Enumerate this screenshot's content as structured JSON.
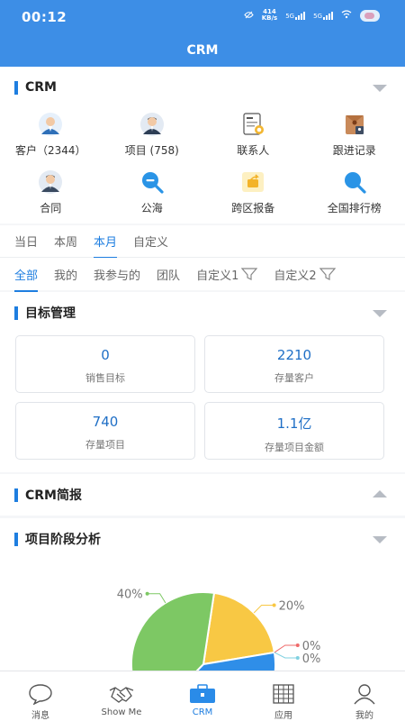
{
  "status_bar": {
    "time": "00:12",
    "network_speed_top": "414",
    "network_speed_bottom": "KB/s",
    "sim1": "5G",
    "sim2": "5G"
  },
  "header": {
    "title": "CRM"
  },
  "crm_section": {
    "title": "CRM",
    "items": [
      {
        "label": "客户（2344）",
        "icon": "customer-avatar-icon"
      },
      {
        "label": "项目 (758)",
        "icon": "project-avatar-icon"
      },
      {
        "label": "联系人",
        "icon": "contact-card-icon"
      },
      {
        "label": "跟进记录",
        "icon": "follow-up-folder-icon"
      },
      {
        "label": "合同",
        "icon": "contract-avatar-icon"
      },
      {
        "label": "公海",
        "icon": "public-pool-search-icon"
      },
      {
        "label": "跨区报备",
        "icon": "cross-region-share-icon"
      },
      {
        "label": "全国排行榜",
        "icon": "ranking-search-icon"
      }
    ]
  },
  "period_tabs": {
    "items": [
      "当日",
      "本周",
      "本月",
      "自定义"
    ],
    "active": "本月"
  },
  "scope_tabs": {
    "items": [
      "全部",
      "我的",
      "我参与的",
      "团队"
    ],
    "filters": [
      "自定义1",
      "自定义2"
    ],
    "active": "全部"
  },
  "target_section": {
    "title": "目标管理",
    "tiles": [
      {
        "value": "0",
        "label": "销售目标"
      },
      {
        "value": "2210",
        "label": "存量客户"
      },
      {
        "value": "740",
        "label": "存量项目"
      },
      {
        "value": "1.1亿",
        "label": "存量项目金额"
      }
    ]
  },
  "brief_section": {
    "title": "CRM简报"
  },
  "stage_section": {
    "title": "项目阶段分析"
  },
  "chart_data": {
    "type": "pie",
    "slices": [
      {
        "label": "40%",
        "value": 40,
        "color": "#7dc864"
      },
      {
        "label": "20%",
        "value": 20,
        "color": "#f8c844"
      },
      {
        "label": "0%",
        "value": 0,
        "color": "#ef6a6a"
      },
      {
        "label": "0%",
        "value": 0,
        "color": "#7fd0e0"
      },
      {
        "value": 40,
        "color": "#2f8ee8"
      }
    ]
  },
  "bottom_nav": {
    "items": [
      {
        "label": "消息",
        "icon": "message-bubble-icon"
      },
      {
        "label": "Show Me",
        "icon": "handshake-icon"
      },
      {
        "label": "CRM",
        "icon": "briefcase-icon"
      },
      {
        "label": "应用",
        "icon": "app-grid-icon"
      },
      {
        "label": "我的",
        "icon": "person-icon"
      }
    ],
    "active": "CRM"
  },
  "colors": {
    "primary": "#3d8ee6",
    "accent": "#1e7ee0"
  }
}
